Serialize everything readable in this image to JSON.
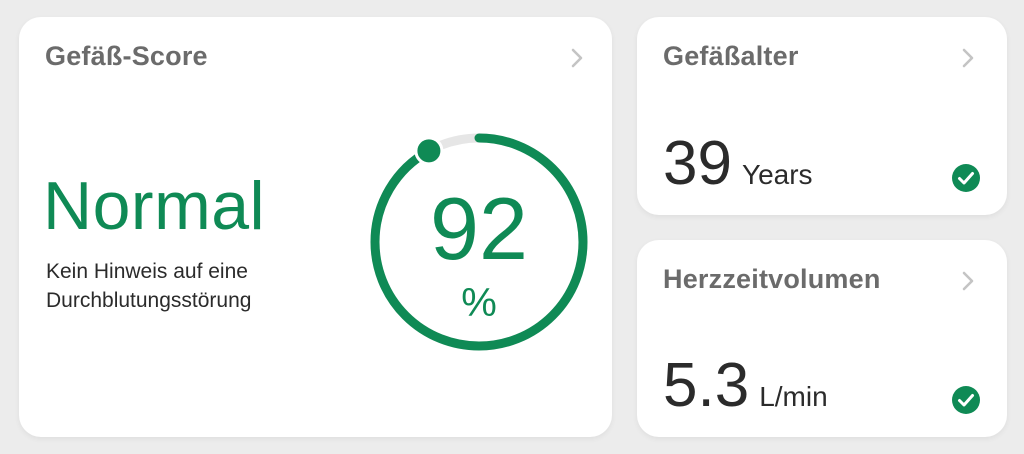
{
  "colors": {
    "accent_green": "#0f8a55",
    "title_gray": "#6b6b6b",
    "chevron_gray": "#c4c4c4",
    "track_gray": "#e6e6e6"
  },
  "score_card": {
    "title": "Gefäß-Score",
    "status": "Normal",
    "description": "Kein Hinweis auf eine Durchblutungsstörung",
    "score_value": "92",
    "score_unit": "%",
    "score_fraction": 0.92,
    "chevron_icon": "chevron-right-icon"
  },
  "age_card": {
    "title": "Gefäßalter",
    "value": "39",
    "unit": "Years",
    "status_icon": "check-circle-icon",
    "chevron_icon": "chevron-right-icon"
  },
  "output_card": {
    "title": "Herzzeitvolumen",
    "value": "5.3",
    "unit": "L/min",
    "status_icon": "check-circle-icon",
    "chevron_icon": "chevron-right-icon"
  }
}
